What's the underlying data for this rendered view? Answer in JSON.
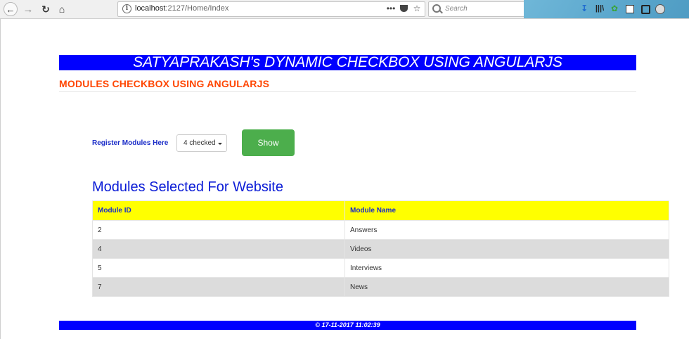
{
  "browser": {
    "url_host": "localhost",
    "url_path": ":2127/Home/Index",
    "search_placeholder": "Search",
    "more_actions": "•••"
  },
  "banner": {
    "title": "SATYAPRAKASH's DYNAMIC CHECKBOX USING ANGULARJS"
  },
  "subheading": "MODULES CHECKBOX USING ANGULARJS",
  "form": {
    "register_label": "Register Modules Here",
    "dropdown_value": "4 checked",
    "show_button": "Show"
  },
  "section_title": "Modules Selected For Website",
  "table": {
    "headers": [
      "Module ID",
      "Module Name"
    ],
    "rows": [
      {
        "id": "2",
        "name": "Answers"
      },
      {
        "id": "4",
        "name": "Videos"
      },
      {
        "id": "5",
        "name": "Interviews"
      },
      {
        "id": "7",
        "name": "News"
      }
    ]
  },
  "footer": "© 17-11-2017 11:02:39",
  "colors": {
    "banner_bg": "#0000ff",
    "subheading": "#ff4500",
    "header_row_bg": "#ffff00",
    "alt_row_bg": "#dcdcdc",
    "show_button_bg": "#4cae4c",
    "section_title": "#0a1bd6"
  },
  "icons": {
    "back": "back-arrow-icon",
    "forward": "forward-arrow-icon",
    "reload": "reload-icon",
    "home": "home-icon",
    "info": "info-icon",
    "pocket": "pocket-icon",
    "bookmark": "star-icon",
    "search": "search-icon",
    "download": "download-icon",
    "library": "library-icon",
    "extension": "extension-icon"
  }
}
